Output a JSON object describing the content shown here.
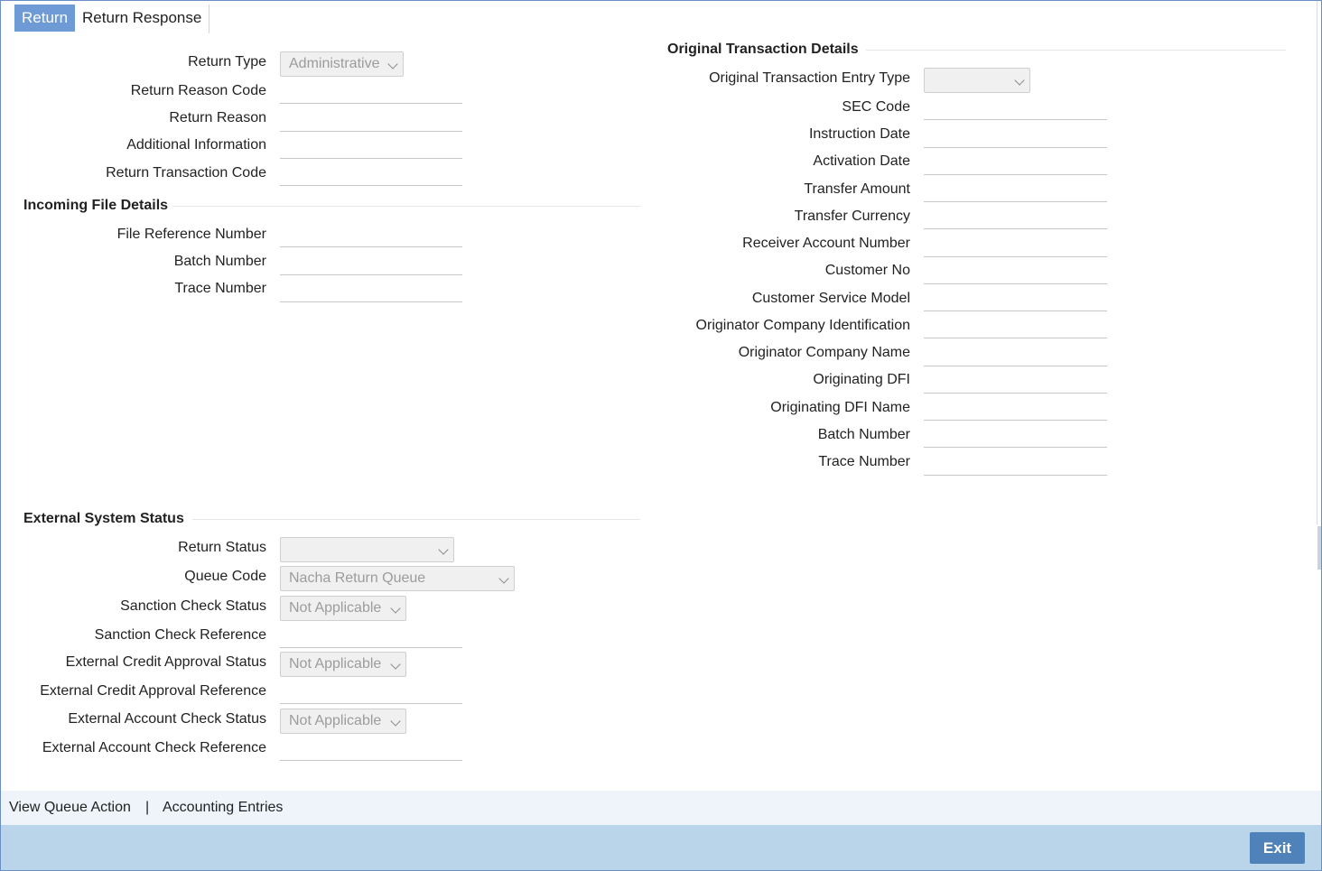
{
  "tabs": [
    {
      "label": "Return",
      "active": true
    },
    {
      "label": "Return Response",
      "active": false
    }
  ],
  "return_section": {
    "return_type": {
      "label": "Return Type",
      "value": "Administrative"
    },
    "return_reason_code": {
      "label": "Return Reason Code",
      "value": ""
    },
    "return_reason": {
      "label": "Return Reason",
      "value": ""
    },
    "additional_information": {
      "label": "Additional Information",
      "value": ""
    },
    "return_transaction_code": {
      "label": "Return Transaction Code",
      "value": ""
    }
  },
  "incoming_file": {
    "title": "Incoming File Details",
    "file_reference_number": {
      "label": "File Reference Number",
      "value": ""
    },
    "batch_number": {
      "label": "Batch Number",
      "value": ""
    },
    "trace_number": {
      "label": "Trace Number",
      "value": ""
    }
  },
  "original_transaction": {
    "title": "Original Transaction Details",
    "entry_type": {
      "label": "Original Transaction Entry Type",
      "value": ""
    },
    "sec_code": {
      "label": "SEC Code",
      "value": ""
    },
    "instruction_date": {
      "label": "Instruction Date",
      "value": ""
    },
    "activation_date": {
      "label": "Activation Date",
      "value": ""
    },
    "transfer_amount": {
      "label": "Transfer Amount",
      "value": ""
    },
    "transfer_currency": {
      "label": "Transfer Currency",
      "value": ""
    },
    "receiver_account_number": {
      "label": "Receiver Account Number",
      "value": ""
    },
    "customer_no": {
      "label": "Customer No",
      "value": ""
    },
    "customer_service_model": {
      "label": "Customer Service Model",
      "value": ""
    },
    "originator_company_identification": {
      "label": "Originator Company Identification",
      "value": ""
    },
    "originator_company_name": {
      "label": "Originator Company Name",
      "value": ""
    },
    "originating_dfi": {
      "label": "Originating DFI",
      "value": ""
    },
    "originating_dfi_name": {
      "label": "Originating DFI Name",
      "value": ""
    },
    "batch_number": {
      "label": "Batch Number",
      "value": ""
    },
    "trace_number": {
      "label": "Trace Number",
      "value": ""
    }
  },
  "external_system": {
    "title": "External System Status",
    "return_status": {
      "label": "Return Status",
      "value": ""
    },
    "queue_code": {
      "label": "Queue Code",
      "value": "Nacha Return Queue"
    },
    "sanction_check_status": {
      "label": "Sanction Check Status",
      "value": "Not Applicable"
    },
    "sanction_check_reference": {
      "label": "Sanction Check Reference",
      "value": ""
    },
    "external_credit_approval_status": {
      "label": "External Credit Approval Status",
      "value": "Not Applicable"
    },
    "external_credit_approval_reference": {
      "label": "External Credit Approval Reference",
      "value": ""
    },
    "external_account_check_status": {
      "label": "External Account Check Status",
      "value": "Not Applicable"
    },
    "external_account_check_reference": {
      "label": "External Account Check Reference",
      "value": ""
    }
  },
  "footer": {
    "view_queue_action": "View Queue Action",
    "separator": "|",
    "accounting_entries": "Accounting Entries",
    "exit": "Exit"
  },
  "colors": {
    "active_tab": "#6e9bd6",
    "footer_bar": "#bad5ea",
    "exit_button": "#4f82b8",
    "frame_border": "#6a8fc4"
  }
}
